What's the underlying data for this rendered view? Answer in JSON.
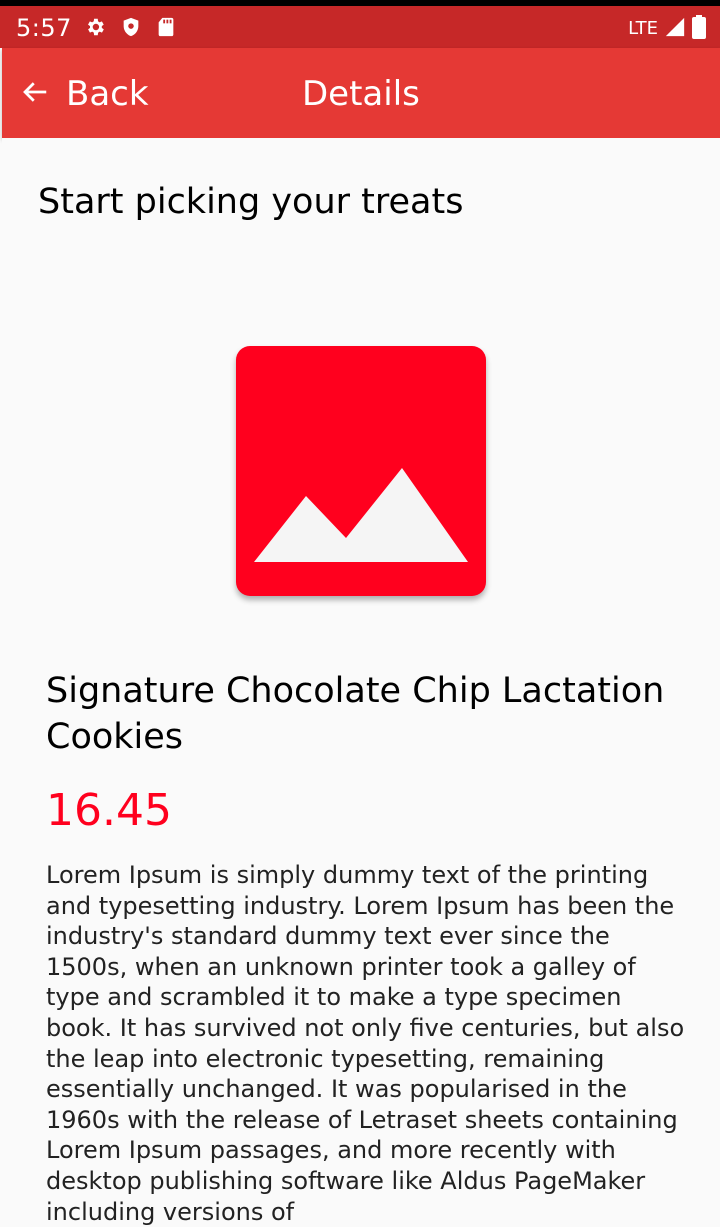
{
  "status_bar": {
    "time": "5:57",
    "network": "LTE",
    "icons": [
      "gear-icon",
      "shield-icon",
      "sd-card-icon",
      "signal-icon",
      "battery-icon"
    ]
  },
  "app_bar": {
    "back_label": "Back",
    "title": "Details",
    "icons": [
      "arrow-left-icon"
    ]
  },
  "main": {
    "section_title": "Start picking your treats",
    "product": {
      "image_icon": "image-placeholder-icon",
      "name": "Signature Chocolate Chip Lactation Cookies",
      "price": "16.45",
      "description": "Lorem Ipsum is simply dummy text of the printing and typesetting industry. Lorem Ipsum has been the industry's standard dummy text ever since the 1500s, when an unknown printer took a galley of type and scrambled it to make a type specimen book. It has survived not only five centuries, but also the leap into electronic typesetting, remaining essentially unchanged. It was popularised in the 1960s with the release of Letraset sheets containing Lorem Ipsum passages, and more recently with desktop publishing software like Aldus PageMaker including versions of"
    }
  },
  "colors": {
    "status_bar": "#c62828",
    "app_bar": "#e53935",
    "accent": "#ff001e",
    "background": "#fafafa"
  }
}
